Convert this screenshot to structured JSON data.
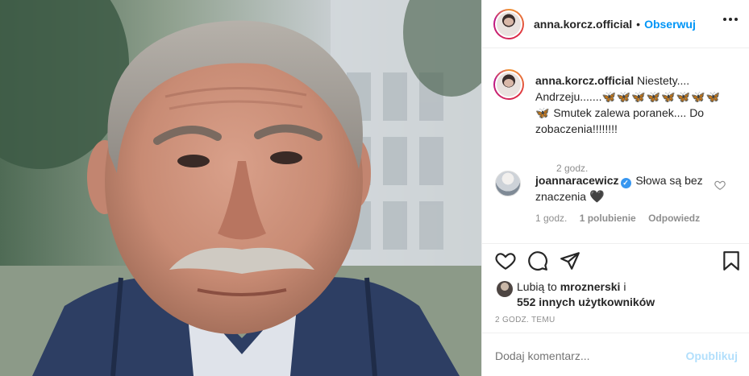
{
  "post": {
    "username": "anna.korcz.official",
    "follow_label": "Obserwuj",
    "dot": "•"
  },
  "caption": {
    "username": "anna.korcz.official",
    "text_line1": "Niestety....",
    "text_line2": "Andrzeju.......",
    "butterflies": "🦋🦋🦋🦋🦋🦋🦋🦋",
    "butterfly_end": "🦋",
    "text_line3": "Smutek zalewa poranek.... Do",
    "text_line4": "zobaczenia!!!!!!!!",
    "time": "2 godz."
  },
  "reply": {
    "username": "joannaracewicz",
    "text": "Słowa są bez znaczenia",
    "heart": "🖤",
    "time": "1 godz.",
    "likes": "1 polubienie",
    "reply_label": "Odpowiedz"
  },
  "likes": {
    "prefix": "Lubią to",
    "user": "mroznerski",
    "connector": "i",
    "others": "552 innych użytkowników"
  },
  "post_time": "2 GODZ. TEMU",
  "comment_box": {
    "placeholder": "Dodaj komentarz...",
    "publish_label": "Opublikuj"
  },
  "colors": {
    "accent_blue": "#0095f6",
    "publish_disabled": "#b2dffc",
    "muted": "#8e8e8e"
  }
}
